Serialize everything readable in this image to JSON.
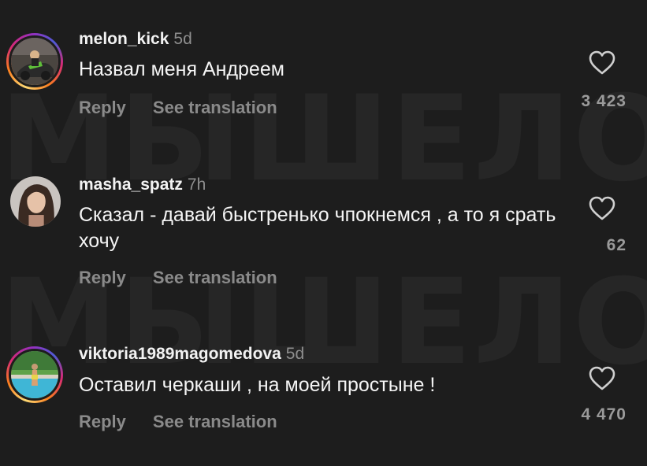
{
  "watermark": "МЫШЕЛОВКА",
  "actions": {
    "reply_label": "Reply",
    "translate_label": "See translation"
  },
  "comments": [
    {
      "username": "melon_kick",
      "time": "5d",
      "text": "Назвал меня Андреем",
      "likes": "3 423",
      "has_story_ring": true
    },
    {
      "username": "masha_spatz",
      "time": "7h",
      "text": "Сказал - давай быстренько чпокнемся , а то я срать хочу",
      "likes": "62",
      "has_story_ring": false
    },
    {
      "username": "viktoria1989magomedova",
      "time": "5d",
      "text": "Оставил черкаши , на моей простыне !",
      "likes": "4 470",
      "has_story_ring": true
    }
  ],
  "colors": {
    "background": "#1d1d1d",
    "username": "#f2f2f2",
    "muted": "#8e8e8e",
    "text": "#f5f5f5"
  }
}
